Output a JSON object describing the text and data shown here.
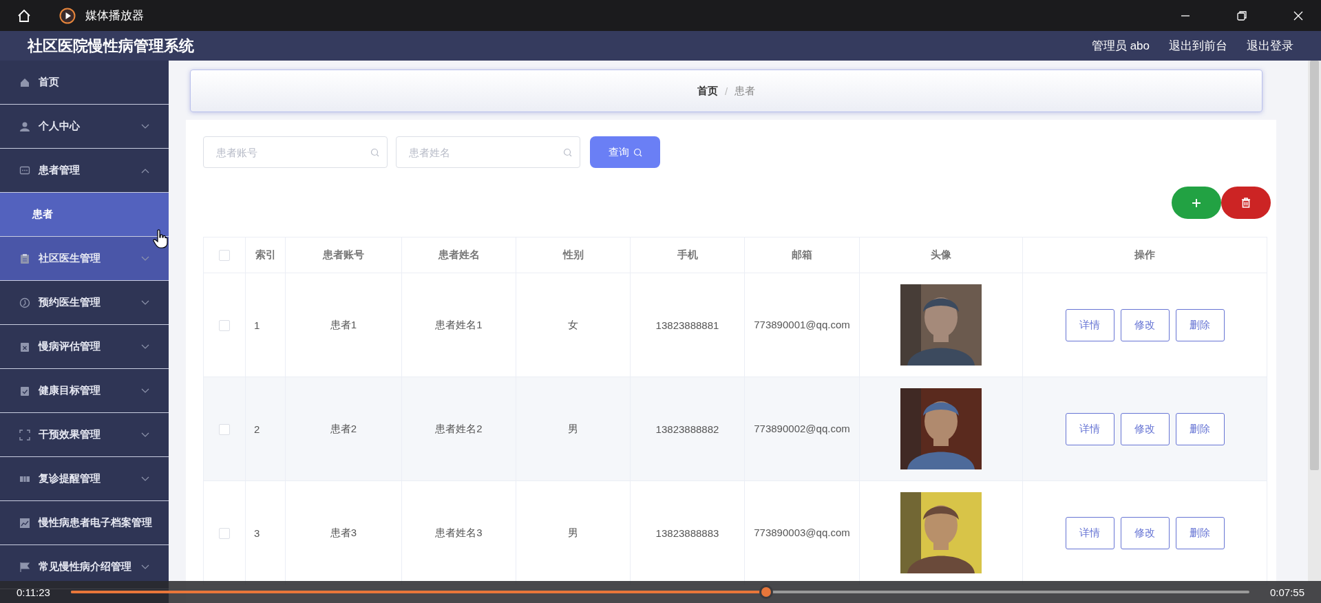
{
  "player": {
    "title": "媒体播放器",
    "elapsed": "0:11:23",
    "remaining": "0:07:55",
    "level": 0.59
  },
  "header": {
    "title": "社区医院慢性病管理系统",
    "links": [
      "管理员 abo",
      "退出到前台",
      "退出登录"
    ]
  },
  "sidebar": {
    "items": [
      {
        "label": "首页",
        "kind": "link",
        "hovered": false
      },
      {
        "label": "个人中心",
        "kind": "submenu",
        "expanded": false,
        "hovered": false
      },
      {
        "label": "患者管理",
        "kind": "submenu",
        "expanded": true,
        "hovered": false,
        "children": [
          {
            "label": "患者",
            "selected": true
          }
        ]
      },
      {
        "label": "社区医生管理",
        "kind": "submenu",
        "expanded": false,
        "hovered": true
      },
      {
        "label": "预约医生管理",
        "kind": "submenu",
        "expanded": false,
        "hovered": false
      },
      {
        "label": "慢病评估管理",
        "kind": "submenu",
        "expanded": false,
        "hovered": false
      },
      {
        "label": "健康目标管理",
        "kind": "submenu",
        "expanded": false,
        "hovered": false
      },
      {
        "label": "干预效果管理",
        "kind": "submenu",
        "expanded": false,
        "hovered": false
      },
      {
        "label": "复诊提醒管理",
        "kind": "submenu",
        "expanded": false,
        "hovered": false
      },
      {
        "label": "慢性病患者电子档案管理",
        "kind": "link",
        "hovered": false
      },
      {
        "label": "常见慢性病介绍管理",
        "kind": "submenu",
        "expanded": false,
        "hovered": false
      }
    ]
  },
  "breadcrumb": {
    "items": [
      "首页",
      "患者"
    ],
    "separator": "/"
  },
  "search": {
    "fields": [
      {
        "placeholder": "患者账号"
      },
      {
        "placeholder": "患者姓名"
      }
    ],
    "button": "查询"
  },
  "table": {
    "all_checked": false,
    "columns": [
      "索引",
      "患者账号",
      "患者姓名",
      "性别",
      "手机",
      "邮箱",
      "头像",
      "操作"
    ],
    "rows": [
      {
        "checked": false,
        "cells": [
          "1",
          "患者1",
          "患者姓名1",
          "女",
          "13823888881",
          "773890001@qq.com"
        ],
        "actions": [
          "详情",
          "修改",
          "删除"
        ]
      },
      {
        "checked": false,
        "cells": [
          "2",
          "患者2",
          "患者姓名2",
          "男",
          "13823888882",
          "773890002@qq.com"
        ],
        "actions": [
          "详情",
          "修改",
          "删除"
        ]
      },
      {
        "checked": false,
        "cells": [
          "3",
          "患者3",
          "患者姓名3",
          "男",
          "13823888883",
          "773890003@qq.com"
        ],
        "actions": [
          "详情",
          "修改",
          "删除"
        ]
      }
    ]
  }
}
